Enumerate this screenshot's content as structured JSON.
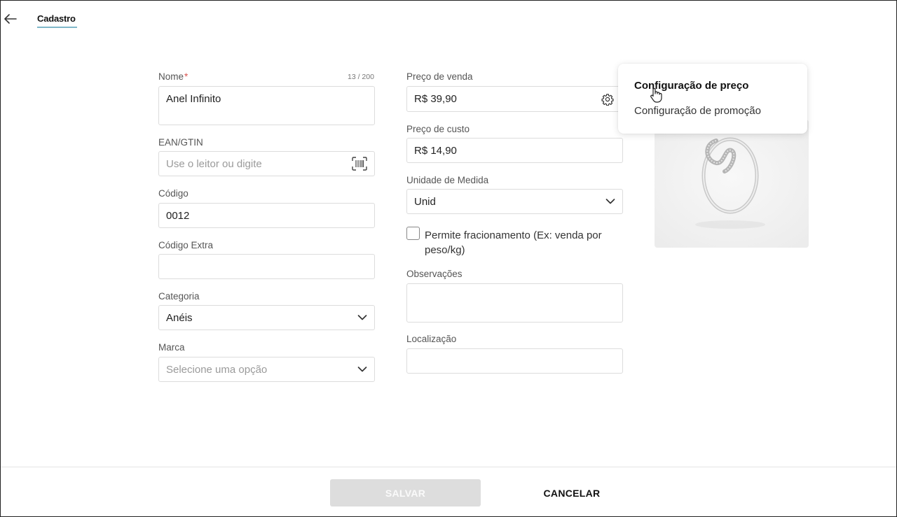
{
  "header": {
    "back_icon": "arrow-left-icon",
    "tab_label": "Cadastro"
  },
  "form_left": {
    "nome": {
      "label": "Nome",
      "required_mark": "*",
      "counter": "13 / 200",
      "value": "Anel Infinito"
    },
    "ean": {
      "label": "EAN/GTIN",
      "placeholder": "Use o leitor ou digite",
      "icon": "barcode-scan-icon"
    },
    "codigo": {
      "label": "Código",
      "value": "0012"
    },
    "codigo_extra": {
      "label": "Código Extra",
      "value": ""
    },
    "categoria": {
      "label": "Categoria",
      "value": "Anéis",
      "icon": "chevron-down-icon"
    },
    "marca": {
      "label": "Marca",
      "placeholder": "Selecione uma opção",
      "icon": "chevron-down-icon"
    }
  },
  "form_right": {
    "preco_venda": {
      "label": "Preço de venda",
      "value": "R$ 39,90",
      "icon": "gear-icon"
    },
    "preco_custo": {
      "label": "Preço de custo",
      "value": "R$ 14,90"
    },
    "unidade": {
      "label": "Unidade de Medida",
      "value": "Unid",
      "icon": "chevron-down-icon"
    },
    "fracionamento": {
      "label": "Permite fracionamento (Ex: venda por peso/kg)",
      "checked": false
    },
    "observacoes": {
      "label": "Observações",
      "value": ""
    },
    "localizacao": {
      "label": "Localização",
      "value": ""
    }
  },
  "price_menu": {
    "items": [
      {
        "label": "Configuração de preço",
        "active": true
      },
      {
        "label": "Configuração de promoção",
        "active": false
      }
    ]
  },
  "footer": {
    "save_label": "SALVAR",
    "cancel_label": "CANCELAR"
  },
  "colors": {
    "tab_underline": "#7fb7c9",
    "required": "#d9534f",
    "save_disabled_bg": "#dddddd"
  }
}
